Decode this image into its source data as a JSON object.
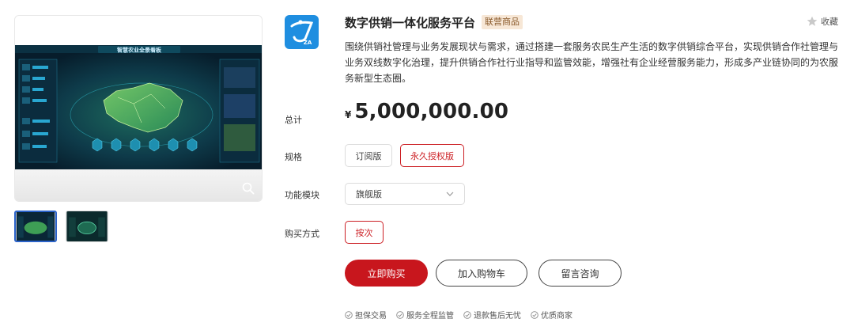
{
  "product": {
    "title": "数字供销一体化服务平台",
    "tag": "联营商品",
    "favorite_label": "收藏",
    "logo_text": "ZA",
    "description": "围绕供销社管理与业务发展现状与需求，通过搭建一套服务农民生产生活的数字供销综合平台，实现供销合作社管理与业务双线数字化治理，提升供销合作社行业指导和监管效能，增强社有企业经营服务能力，形成多产业链协同的为农服务新型生态圈。"
  },
  "gallery": {
    "dashboard_title": "智慧农业全景看板",
    "thumbnail_count": 2
  },
  "pricing": {
    "total_label": "总计",
    "currency": "¥",
    "amount": "5,000,000.00"
  },
  "spec": {
    "label": "规格",
    "options": [
      "订阅版",
      "永久授权版"
    ],
    "selected": "永久授权版"
  },
  "module": {
    "label": "功能模块",
    "value": "旗舰版"
  },
  "payment": {
    "label": "购买方式",
    "options": [
      "按次"
    ],
    "selected": "按次"
  },
  "actions": {
    "buy": "立即购买",
    "cart": "加入购物车",
    "message": "留言咨询"
  },
  "guarantees": [
    "担保交易",
    "服务全程监管",
    "退款售后无忧",
    "优质商家"
  ],
  "colors": {
    "accent": "#c8161d",
    "tag_bg": "#f7e7d6",
    "logo_bg": "#1f8ee0",
    "dashboard_bg": "#0a2a3a"
  },
  "icons": {
    "favorite": "star-icon",
    "zoom": "search-icon",
    "dropdown": "chevron-down-icon",
    "guarantee": "check-circle-icon"
  }
}
